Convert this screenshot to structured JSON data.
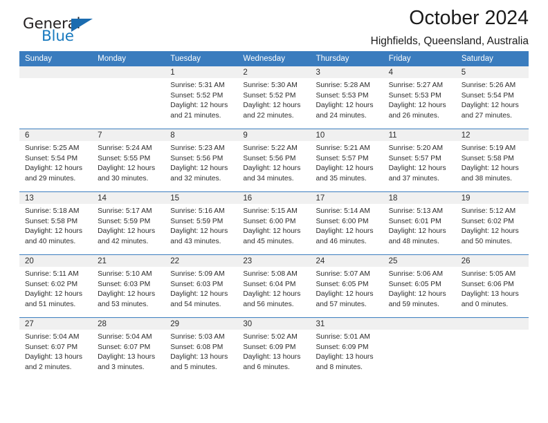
{
  "brand": {
    "name_primary": "General",
    "name_secondary": "Blue",
    "logo_icon": "triangle-logo-icon",
    "primary_color": "#231f20",
    "accent_color": "#1b7bbf"
  },
  "header": {
    "title": "October 2024",
    "subtitle": "Highfields, Queensland, Australia"
  },
  "theme": {
    "header_row_bg": "#3a7cbe",
    "day_band_bg": "#f0f0f0",
    "week_divider": "#3a7cbe",
    "text": "#2b2b2b"
  },
  "weekdays": [
    {
      "label": "Sunday"
    },
    {
      "label": "Monday"
    },
    {
      "label": "Tuesday"
    },
    {
      "label": "Wednesday"
    },
    {
      "label": "Thursday"
    },
    {
      "label": "Friday"
    },
    {
      "label": "Saturday"
    }
  ],
  "weeks": [
    {
      "days": [
        {
          "num": "",
          "empty": true,
          "sunrise": "",
          "sunset": "",
          "daylight1": "",
          "daylight2": ""
        },
        {
          "num": "",
          "empty": true,
          "sunrise": "",
          "sunset": "",
          "daylight1": "",
          "daylight2": ""
        },
        {
          "num": "1",
          "sunrise": "Sunrise: 5:31 AM",
          "sunset": "Sunset: 5:52 PM",
          "daylight1": "Daylight: 12 hours",
          "daylight2": "and 21 minutes."
        },
        {
          "num": "2",
          "sunrise": "Sunrise: 5:30 AM",
          "sunset": "Sunset: 5:52 PM",
          "daylight1": "Daylight: 12 hours",
          "daylight2": "and 22 minutes."
        },
        {
          "num": "3",
          "sunrise": "Sunrise: 5:28 AM",
          "sunset": "Sunset: 5:53 PM",
          "daylight1": "Daylight: 12 hours",
          "daylight2": "and 24 minutes."
        },
        {
          "num": "4",
          "sunrise": "Sunrise: 5:27 AM",
          "sunset": "Sunset: 5:53 PM",
          "daylight1": "Daylight: 12 hours",
          "daylight2": "and 26 minutes."
        },
        {
          "num": "5",
          "sunrise": "Sunrise: 5:26 AM",
          "sunset": "Sunset: 5:54 PM",
          "daylight1": "Daylight: 12 hours",
          "daylight2": "and 27 minutes."
        }
      ]
    },
    {
      "days": [
        {
          "num": "6",
          "sunrise": "Sunrise: 5:25 AM",
          "sunset": "Sunset: 5:54 PM",
          "daylight1": "Daylight: 12 hours",
          "daylight2": "and 29 minutes."
        },
        {
          "num": "7",
          "sunrise": "Sunrise: 5:24 AM",
          "sunset": "Sunset: 5:55 PM",
          "daylight1": "Daylight: 12 hours",
          "daylight2": "and 30 minutes."
        },
        {
          "num": "8",
          "sunrise": "Sunrise: 5:23 AM",
          "sunset": "Sunset: 5:56 PM",
          "daylight1": "Daylight: 12 hours",
          "daylight2": "and 32 minutes."
        },
        {
          "num": "9",
          "sunrise": "Sunrise: 5:22 AM",
          "sunset": "Sunset: 5:56 PM",
          "daylight1": "Daylight: 12 hours",
          "daylight2": "and 34 minutes."
        },
        {
          "num": "10",
          "sunrise": "Sunrise: 5:21 AM",
          "sunset": "Sunset: 5:57 PM",
          "daylight1": "Daylight: 12 hours",
          "daylight2": "and 35 minutes."
        },
        {
          "num": "11",
          "sunrise": "Sunrise: 5:20 AM",
          "sunset": "Sunset: 5:57 PM",
          "daylight1": "Daylight: 12 hours",
          "daylight2": "and 37 minutes."
        },
        {
          "num": "12",
          "sunrise": "Sunrise: 5:19 AM",
          "sunset": "Sunset: 5:58 PM",
          "daylight1": "Daylight: 12 hours",
          "daylight2": "and 38 minutes."
        }
      ]
    },
    {
      "days": [
        {
          "num": "13",
          "sunrise": "Sunrise: 5:18 AM",
          "sunset": "Sunset: 5:58 PM",
          "daylight1": "Daylight: 12 hours",
          "daylight2": "and 40 minutes."
        },
        {
          "num": "14",
          "sunrise": "Sunrise: 5:17 AM",
          "sunset": "Sunset: 5:59 PM",
          "daylight1": "Daylight: 12 hours",
          "daylight2": "and 42 minutes."
        },
        {
          "num": "15",
          "sunrise": "Sunrise: 5:16 AM",
          "sunset": "Sunset: 5:59 PM",
          "daylight1": "Daylight: 12 hours",
          "daylight2": "and 43 minutes."
        },
        {
          "num": "16",
          "sunrise": "Sunrise: 5:15 AM",
          "sunset": "Sunset: 6:00 PM",
          "daylight1": "Daylight: 12 hours",
          "daylight2": "and 45 minutes."
        },
        {
          "num": "17",
          "sunrise": "Sunrise: 5:14 AM",
          "sunset": "Sunset: 6:00 PM",
          "daylight1": "Daylight: 12 hours",
          "daylight2": "and 46 minutes."
        },
        {
          "num": "18",
          "sunrise": "Sunrise: 5:13 AM",
          "sunset": "Sunset: 6:01 PM",
          "daylight1": "Daylight: 12 hours",
          "daylight2": "and 48 minutes."
        },
        {
          "num": "19",
          "sunrise": "Sunrise: 5:12 AM",
          "sunset": "Sunset: 6:02 PM",
          "daylight1": "Daylight: 12 hours",
          "daylight2": "and 50 minutes."
        }
      ]
    },
    {
      "days": [
        {
          "num": "20",
          "sunrise": "Sunrise: 5:11 AM",
          "sunset": "Sunset: 6:02 PM",
          "daylight1": "Daylight: 12 hours",
          "daylight2": "and 51 minutes."
        },
        {
          "num": "21",
          "sunrise": "Sunrise: 5:10 AM",
          "sunset": "Sunset: 6:03 PM",
          "daylight1": "Daylight: 12 hours",
          "daylight2": "and 53 minutes."
        },
        {
          "num": "22",
          "sunrise": "Sunrise: 5:09 AM",
          "sunset": "Sunset: 6:03 PM",
          "daylight1": "Daylight: 12 hours",
          "daylight2": "and 54 minutes."
        },
        {
          "num": "23",
          "sunrise": "Sunrise: 5:08 AM",
          "sunset": "Sunset: 6:04 PM",
          "daylight1": "Daylight: 12 hours",
          "daylight2": "and 56 minutes."
        },
        {
          "num": "24",
          "sunrise": "Sunrise: 5:07 AM",
          "sunset": "Sunset: 6:05 PM",
          "daylight1": "Daylight: 12 hours",
          "daylight2": "and 57 minutes."
        },
        {
          "num": "25",
          "sunrise": "Sunrise: 5:06 AM",
          "sunset": "Sunset: 6:05 PM",
          "daylight1": "Daylight: 12 hours",
          "daylight2": "and 59 minutes."
        },
        {
          "num": "26",
          "sunrise": "Sunrise: 5:05 AM",
          "sunset": "Sunset: 6:06 PM",
          "daylight1": "Daylight: 13 hours",
          "daylight2": "and 0 minutes."
        }
      ]
    },
    {
      "days": [
        {
          "num": "27",
          "sunrise": "Sunrise: 5:04 AM",
          "sunset": "Sunset: 6:07 PM",
          "daylight1": "Daylight: 13 hours",
          "daylight2": "and 2 minutes."
        },
        {
          "num": "28",
          "sunrise": "Sunrise: 5:04 AM",
          "sunset": "Sunset: 6:07 PM",
          "daylight1": "Daylight: 13 hours",
          "daylight2": "and 3 minutes."
        },
        {
          "num": "29",
          "sunrise": "Sunrise: 5:03 AM",
          "sunset": "Sunset: 6:08 PM",
          "daylight1": "Daylight: 13 hours",
          "daylight2": "and 5 minutes."
        },
        {
          "num": "30",
          "sunrise": "Sunrise: 5:02 AM",
          "sunset": "Sunset: 6:09 PM",
          "daylight1": "Daylight: 13 hours",
          "daylight2": "and 6 minutes."
        },
        {
          "num": "31",
          "sunrise": "Sunrise: 5:01 AM",
          "sunset": "Sunset: 6:09 PM",
          "daylight1": "Daylight: 13 hours",
          "daylight2": "and 8 minutes."
        },
        {
          "num": "",
          "empty": true,
          "sunrise": "",
          "sunset": "",
          "daylight1": "",
          "daylight2": ""
        },
        {
          "num": "",
          "empty": true,
          "sunrise": "",
          "sunset": "",
          "daylight1": "",
          "daylight2": ""
        }
      ]
    }
  ]
}
